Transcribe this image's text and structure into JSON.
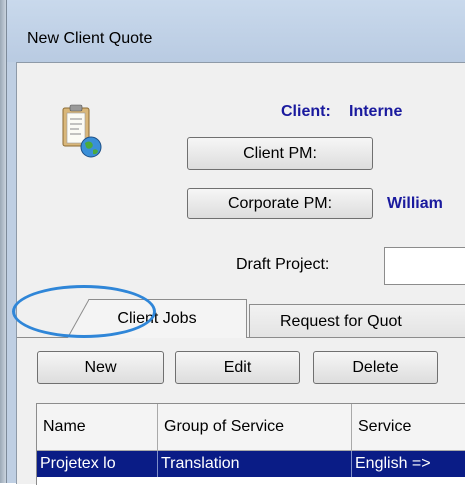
{
  "window": {
    "title": "New Client Quote"
  },
  "client": {
    "label": "Client:",
    "value": "Interne"
  },
  "buttons": {
    "client_pm": "Client PM:",
    "corporate_pm": "Corporate PM:",
    "new": "New",
    "edit": "Edit",
    "delete": "Delete"
  },
  "corporate_pm_value": "William",
  "draft_project": {
    "label": "Draft Project:",
    "value": ""
  },
  "tabs": [
    {
      "label": "Client Jobs",
      "active": true
    },
    {
      "label": "Request for Quot",
      "active": false
    }
  ],
  "table": {
    "columns": [
      "Name",
      "Group of Service",
      "Service"
    ],
    "rows": [
      [
        "Projetex lo",
        "Translation",
        "English =>"
      ]
    ]
  },
  "colors": {
    "title_bar": "#bfcfe3",
    "selected_row": "#0a1c86",
    "emphasis_text": "#1a1a9e",
    "highlight_ring": "#2f86d8"
  }
}
